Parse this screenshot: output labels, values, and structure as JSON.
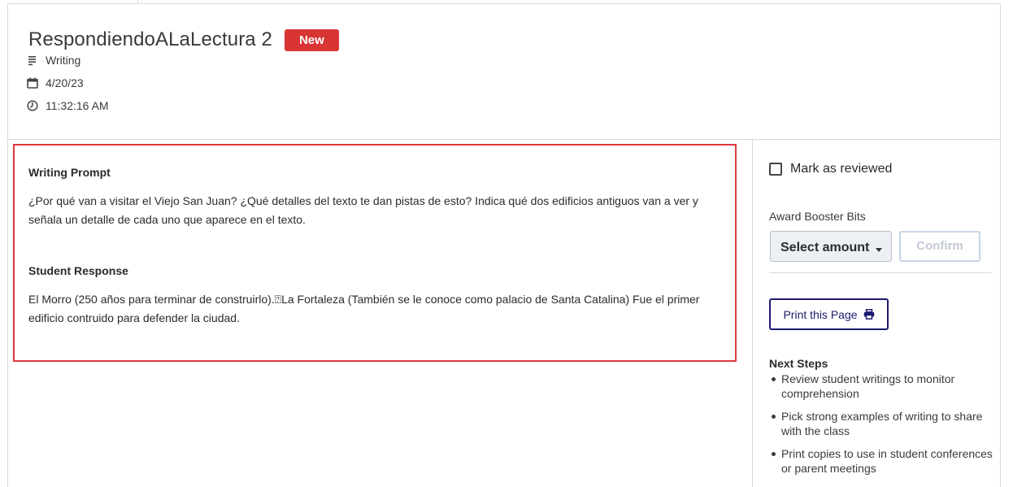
{
  "header": {
    "title": "RespondiendoALaLectura 2",
    "badge": "New",
    "meta": [
      {
        "icon": "list-icon",
        "text": "Writing"
      },
      {
        "icon": "calendar-icon",
        "text": "4/20/23"
      },
      {
        "icon": "clock-icon",
        "text": "11:32:16 AM"
      }
    ]
  },
  "prompt": {
    "writing_prompt_heading": "Writing Prompt",
    "writing_prompt_text": "¿Por qué van a visitar el Viejo San Juan? ¿Qué detalles del texto te dan pistas de esto? Indica qué dos edificios antiguos van a ver y señala un detalle de cada uno que aparece en el texto.",
    "student_response_heading": "Student Response",
    "student_response_text": "El Morro (250 años para terminar de construirlo).⍰La Fortaleza (También se le conoce como palacio de Santa Catalina) Fue el primer edificio contruido para defender la ciudad.",
    "highlight_color": "#e0393f"
  },
  "sidebar": {
    "mark_reviewed_label": "Mark as reviewed",
    "award_label": "Award Booster Bits",
    "select_value": "Select amount",
    "confirm_label": "Confirm",
    "print_label": "Print this Page",
    "next_steps_title": "Next Steps",
    "next_steps": [
      "Review student writings to monitor comprehension",
      "Pick strong examples of writing to share with the class",
      "Print copies to use in student conferences or parent meetings"
    ]
  },
  "colors": {
    "badge": "#d93535",
    "print_button": "#1d1a6e"
  }
}
